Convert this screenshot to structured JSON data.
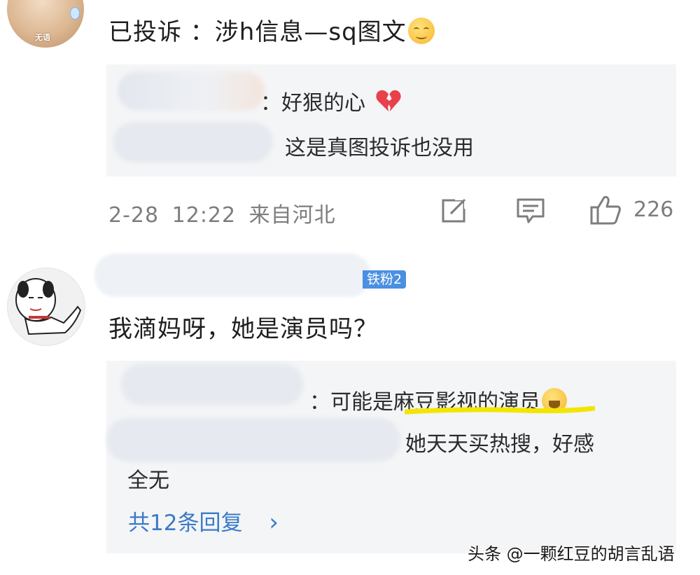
{
  "comment1": {
    "avatar_tag": "无语",
    "text": "已投诉 ：涉h信息—sq图文",
    "emoji_icon": "smile-emoji-icon",
    "replies": [
      {
        "text": "：好狠的心",
        "emoji_icon": "broken-heart-icon"
      },
      {
        "text": "这是真图投诉也没用"
      }
    ],
    "date": "2-28",
    "time": "12:22",
    "location": "来自河北",
    "like_count": "226"
  },
  "comment2": {
    "fan_badge": "铁粉2",
    "text": "我滴妈呀，她是演员吗？",
    "replies": [
      {
        "prefix": "：",
        "text_plain": "可能是",
        "text_highlight": "麻豆影视的演员",
        "emoji_icon": "laugh-tears-icon"
      },
      {
        "text": "她天天买热搜，好感",
        "text_cont": "全无"
      }
    ],
    "more_replies": "共12条回复",
    "more_arrow": "›"
  },
  "watermark": "头条 @一颗红豆的胡言乱语",
  "colors": {
    "link": "#3b7bc7",
    "badge": "#4a90e2",
    "meta": "#7d7d7d",
    "reply_bg": "#f4f5f7",
    "highlight": "#f2e600"
  }
}
